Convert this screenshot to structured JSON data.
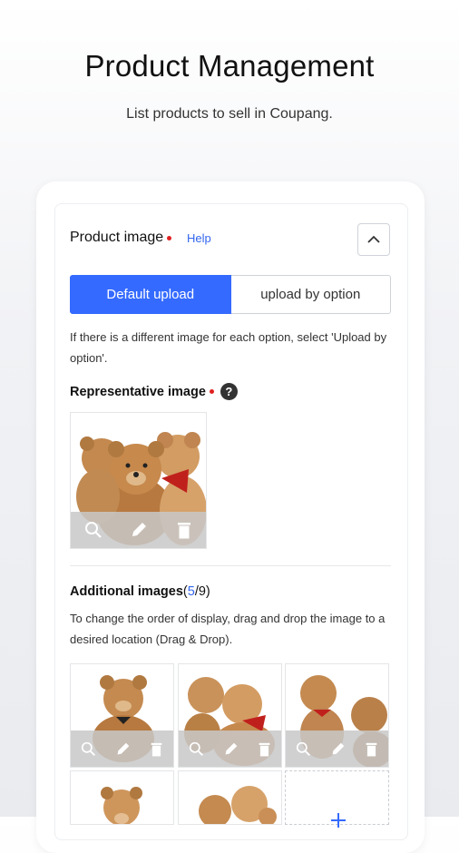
{
  "header": {
    "title": "Product Management",
    "subtitle": "List products to sell in Coupang."
  },
  "product_image": {
    "title": "Product image",
    "help_label": "Help",
    "collapse_icon": "chevron-up-icon",
    "tabs": [
      {
        "label": "Default upload",
        "selected": true
      },
      {
        "label": "upload by option",
        "selected": false
      }
    ],
    "option_hint": "If there is a different image for each option, select 'Upload by option'.",
    "representative": {
      "title": "Representative image",
      "actions": [
        "zoom-icon",
        "edit-icon",
        "delete-icon"
      ]
    },
    "additional": {
      "title": "Additional images",
      "count_current": "5",
      "count_separator": "/",
      "count_max": "9",
      "hint": "To change the order of display, drag and drop the image to a desired location (Drag & Drop).",
      "images": 5,
      "add_tile": true
    }
  },
  "colors": {
    "accent": "#346aff",
    "link": "#3366ee",
    "required_dot": "#e02020"
  }
}
